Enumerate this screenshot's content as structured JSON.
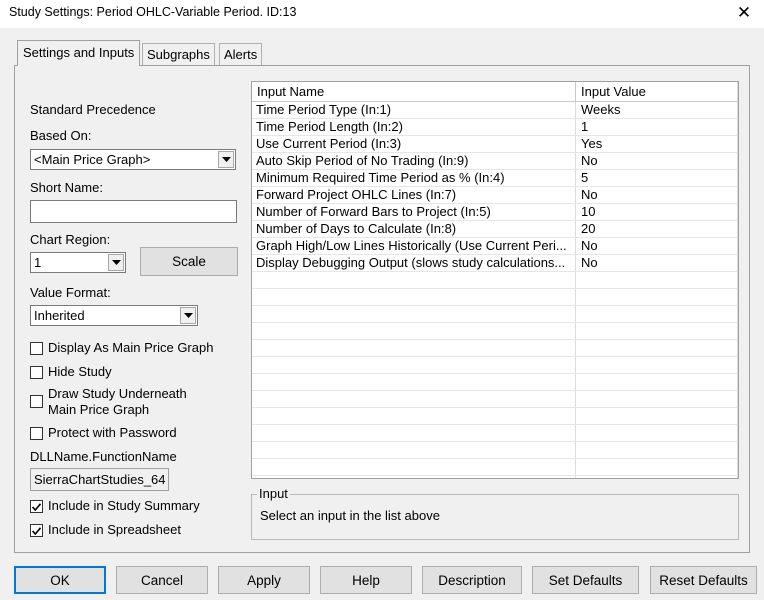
{
  "window": {
    "title": "Study Settings: Period OHLC-Variable Period. ID:13",
    "close_label": "✕"
  },
  "tabs": [
    {
      "label": "Settings and Inputs"
    },
    {
      "label": "Subgraphs"
    },
    {
      "label": "Alerts"
    }
  ],
  "left": {
    "standard_precedence": "Standard Precedence",
    "based_on_label": "Based On:",
    "based_on_value": "<Main Price Graph>",
    "short_name_label": "Short Name:",
    "short_name_value": "",
    "chart_region_label": "Chart Region:",
    "chart_region_value": "1",
    "scale_button": "Scale",
    "value_format_label": "Value Format:",
    "value_format_value": "Inherited",
    "checks": [
      {
        "label": "Display As Main Price Graph",
        "checked": false
      },
      {
        "label": "Hide Study",
        "checked": false
      },
      {
        "label": "Draw Study Underneath\nMain Price Graph",
        "checked": false
      },
      {
        "label": "Protect with Password",
        "checked": false
      }
    ],
    "dll_label": "DLLName.FunctionName",
    "dll_value": "SierraChartStudies_64",
    "checks2": [
      {
        "label": "Include in Study Summary",
        "checked": true
      },
      {
        "label": "Include in Spreadsheet",
        "checked": true
      }
    ]
  },
  "grid": {
    "headers": [
      "Input Name",
      "Input Value"
    ],
    "rows": [
      {
        "name": "Time Period Type   (In:1)",
        "value": "Weeks"
      },
      {
        "name": "Time Period Length   (In:2)",
        "value": "1"
      },
      {
        "name": "Use Current Period   (In:3)",
        "value": "Yes"
      },
      {
        "name": "Auto Skip Period of No Trading   (In:9)",
        "value": "No"
      },
      {
        "name": "Minimum Required Time Period as %   (In:4)",
        "value": "5"
      },
      {
        "name": "Forward Project OHLC Lines   (In:7)",
        "value": "No"
      },
      {
        "name": "Number of Forward Bars to Project   (In:5)",
        "value": "10"
      },
      {
        "name": "Number of Days to Calculate   (In:8)",
        "value": "20"
      },
      {
        "name": "Graph High/Low Lines Historically (Use Current Peri...",
        "value": "No"
      },
      {
        "name": "Display Debugging Output (slows study calculations...",
        "value": "No"
      }
    ]
  },
  "input_group": {
    "legend": "Input",
    "text": "Select an input in the list above"
  },
  "buttons": {
    "ok": "OK",
    "cancel": "Cancel",
    "apply": "Apply",
    "help": "Help",
    "description": "Description",
    "set_defaults": "Set Defaults",
    "reset_defaults": "Reset Defaults"
  }
}
